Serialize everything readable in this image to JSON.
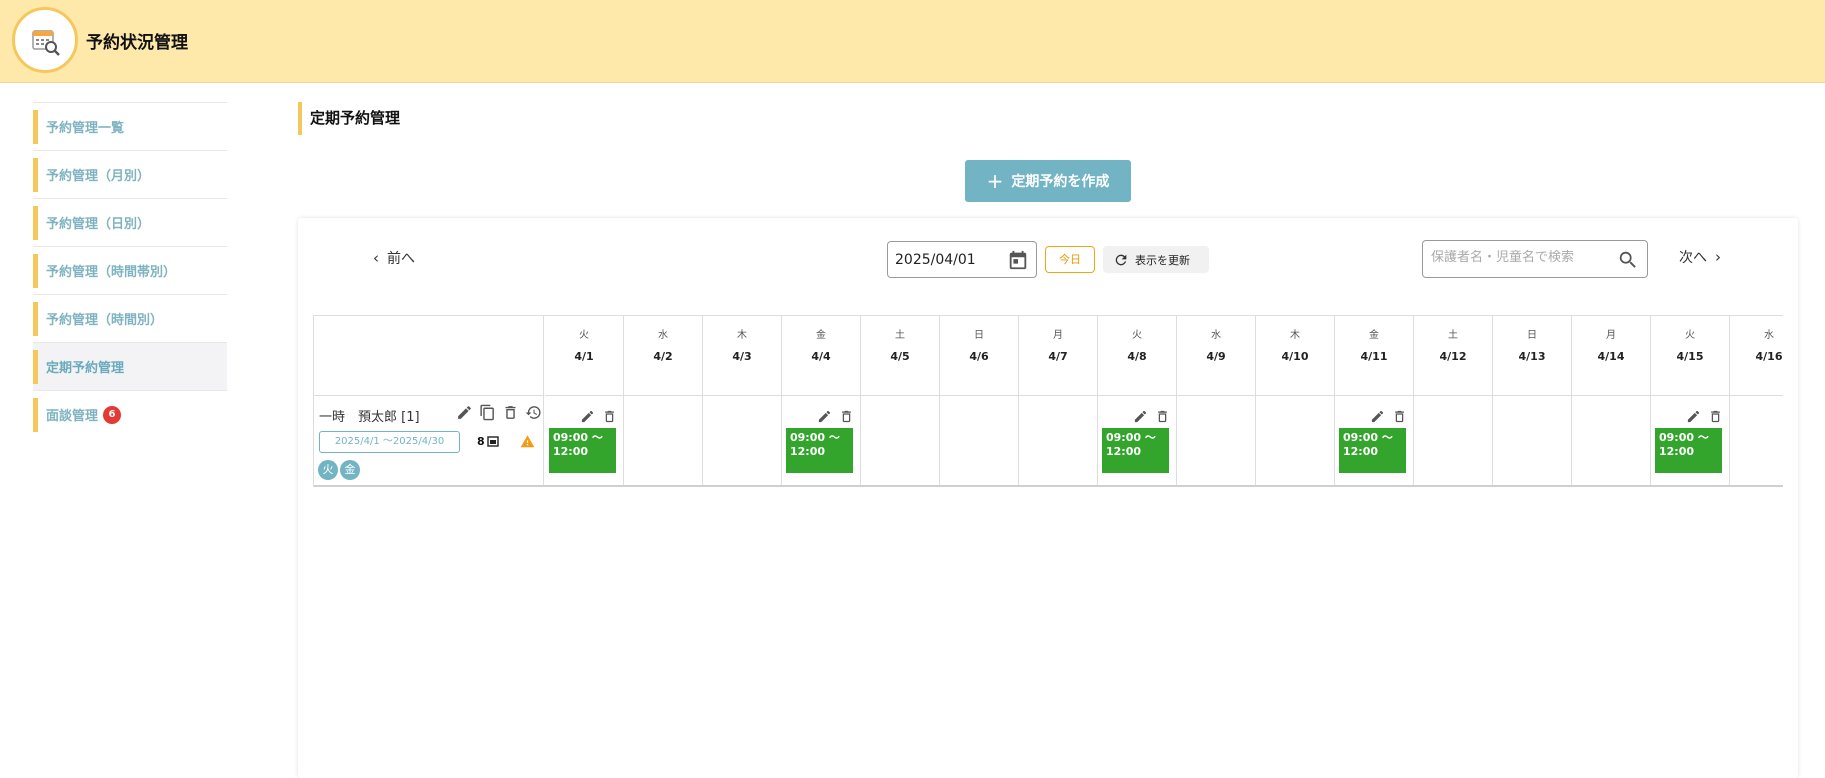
{
  "app": {
    "title": "予約状況管理"
  },
  "sidebar": {
    "items": [
      {
        "label": "予約管理一覧"
      },
      {
        "label": "予約管理（月別）"
      },
      {
        "label": "予約管理（日別）"
      },
      {
        "label": "予約管理（時間帯別）"
      },
      {
        "label": "予約管理（時間別）"
      },
      {
        "label": "定期予約管理"
      },
      {
        "label": "面談管理",
        "badge": "6"
      }
    ]
  },
  "page": {
    "title": "定期予約管理",
    "create_label": "定期予約を作成"
  },
  "toolbar": {
    "prev_label": "前へ",
    "next_label": "次へ",
    "date_value": "2025/04/01",
    "today_label": "今日",
    "refresh_label": "表示を更新",
    "search_placeholder": "保護者名・児童名で検索"
  },
  "calendar": {
    "days": [
      {
        "dow": "火",
        "date": "4/1"
      },
      {
        "dow": "水",
        "date": "4/2"
      },
      {
        "dow": "木",
        "date": "4/3"
      },
      {
        "dow": "金",
        "date": "4/4"
      },
      {
        "dow": "土",
        "date": "4/5"
      },
      {
        "dow": "日",
        "date": "4/6"
      },
      {
        "dow": "月",
        "date": "4/7"
      },
      {
        "dow": "火",
        "date": "4/8"
      },
      {
        "dow": "水",
        "date": "4/9"
      },
      {
        "dow": "木",
        "date": "4/10"
      },
      {
        "dow": "金",
        "date": "4/11"
      },
      {
        "dow": "土",
        "date": "4/12"
      },
      {
        "dow": "日",
        "date": "4/13"
      },
      {
        "dow": "月",
        "date": "4/14"
      },
      {
        "dow": "火",
        "date": "4/15"
      },
      {
        "dow": "水",
        "date": "4/16"
      }
    ],
    "reservation": {
      "name": "一時　預太郎 [1]",
      "period": "2025/4/1 ～2025/4/30",
      "count": "8",
      "weekdays": [
        "火",
        "金"
      ],
      "event_time": "09:00 ～ 12:00",
      "event_days": [
        "4/1",
        "4/4",
        "4/8",
        "4/11",
        "4/15"
      ]
    }
  },
  "colors": {
    "header": "#fee9aa",
    "accent": "#f5c85c",
    "primary": "#72b4c4",
    "event": "#33a52c"
  },
  "icons": [
    "calendar-search-icon",
    "calendar-icon",
    "refresh-icon",
    "search-icon",
    "edit-icon",
    "copy-icon",
    "delete-icon",
    "history-icon",
    "warning-icon",
    "chevron-left-icon",
    "chevron-right-icon",
    "plus-icon"
  ]
}
